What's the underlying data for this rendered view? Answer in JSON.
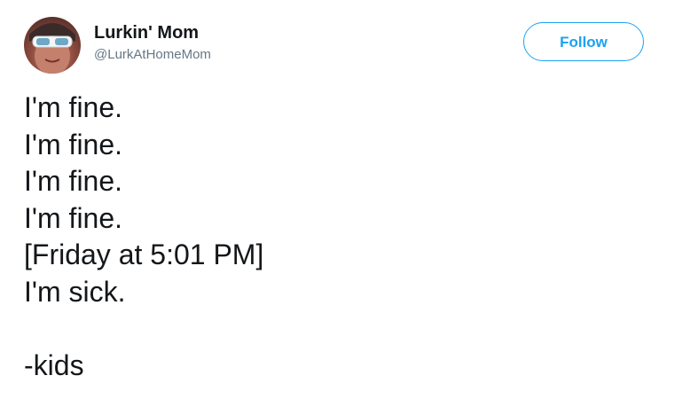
{
  "author": {
    "display_name": "Lurkin' Mom",
    "handle": "@LurkAtHomeMom"
  },
  "actions": {
    "follow_label": "Follow"
  },
  "tweet": {
    "lines": [
      "I'm fine.",
      "I'm fine.",
      "I'm fine.",
      "I'm fine.",
      "[Friday at 5:01 PM]",
      "I'm sick.",
      "",
      "-kids"
    ]
  },
  "colors": {
    "accent": "#1da1f2",
    "text": "#14171a",
    "muted": "#657786"
  }
}
